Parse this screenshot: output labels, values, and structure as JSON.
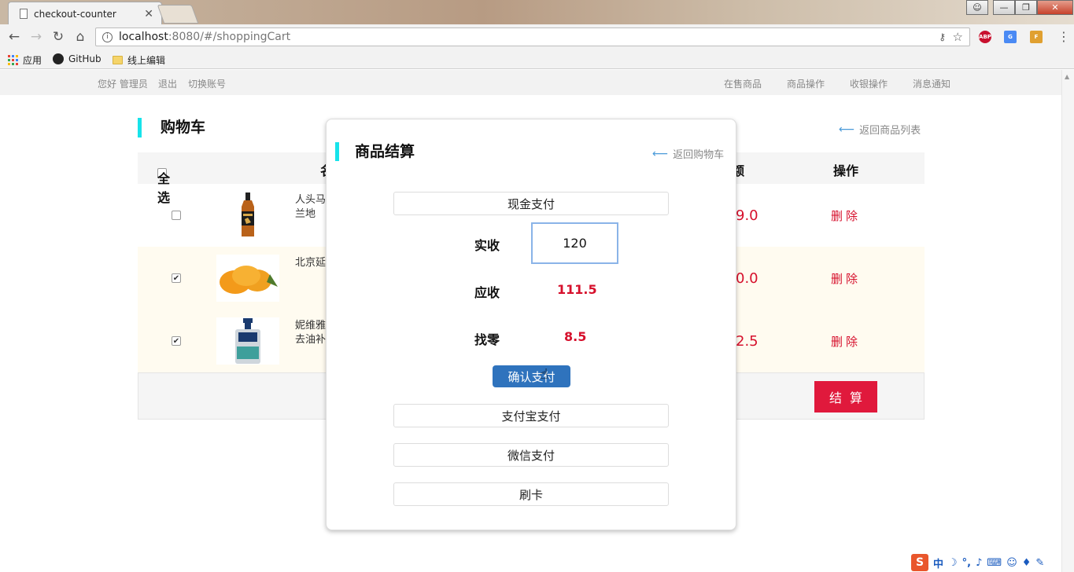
{
  "browser": {
    "tab_title": "checkout-counter",
    "tab_close": "✕",
    "url_host": "localhost",
    "url_path": ":8080/#/shoppingCart",
    "bookmarks": [
      "应用",
      "GitHub",
      "线上编辑"
    ],
    "win_min": "—",
    "win_max": "❐",
    "win_close": "✕",
    "ext_abp": "ABP"
  },
  "nav": {
    "greeting": "您好 管理员",
    "logout": "退出",
    "switch_account": "切换账号",
    "menu": [
      "在售商品",
      "商品操作",
      "收银操作",
      "消息通知"
    ]
  },
  "cart": {
    "title": "购物车",
    "back_label": "返回商品列表",
    "headers": {
      "select_all": "全选",
      "name": "名",
      "amount": "额",
      "action": "操作"
    },
    "rows": [
      {
        "name": "人头马兰地",
        "amount": "9.0",
        "delete": "删除",
        "checked": false
      },
      {
        "name": "北京延",
        "amount": "0.0",
        "delete": "删除",
        "checked": true
      },
      {
        "name": "妮维雅去油补",
        "amount": "2.5",
        "delete": "删除",
        "checked": true
      }
    ],
    "checkout_label": "结算"
  },
  "modal": {
    "title": "商品结算",
    "back_label": "返回购物车",
    "cash": "现金支付",
    "actual_label": "实收",
    "actual_value": "120",
    "due_label": "应收",
    "due_value": "111.5",
    "change_label": "找零",
    "change_value": "8.5",
    "confirm": "确认支付",
    "alipay": "支付宝支付",
    "wechat": "微信支付",
    "card": "刷卡"
  },
  "tray": {
    "ime": "S",
    "lang": "中"
  },
  "colors": {
    "accent_bar": "#17e3ea",
    "price_red": "#d6102c",
    "confirm_blue": "#2f73bd",
    "checkout_red": "#e0193c"
  }
}
